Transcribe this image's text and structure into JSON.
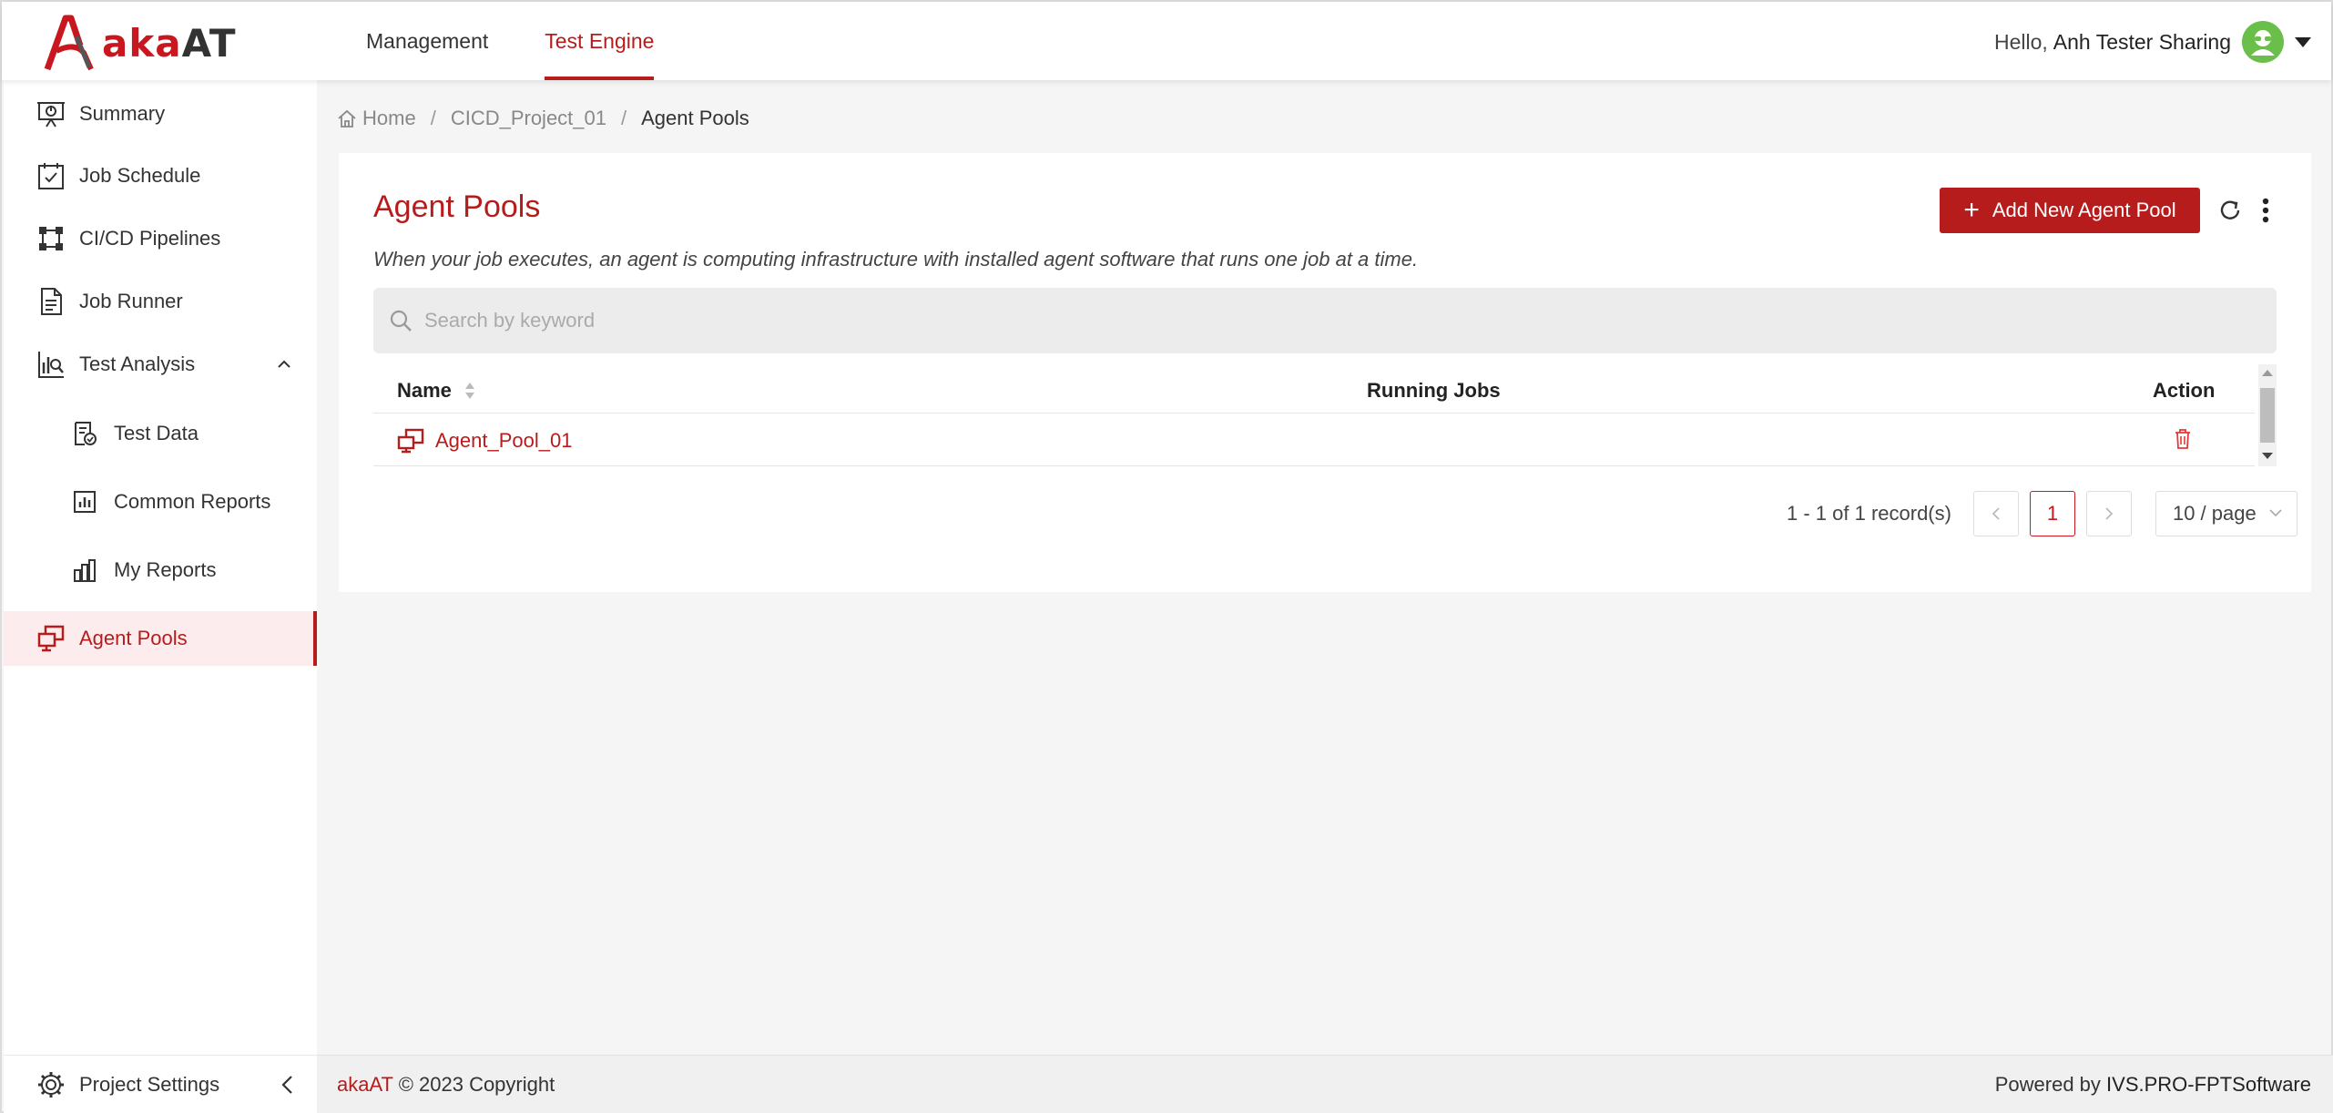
{
  "brand": {
    "logo_aka": "aka",
    "logo_at": "AT",
    "accent": "#b71c1c"
  },
  "topnav": {
    "items": [
      {
        "label": "Management",
        "active": false
      },
      {
        "label": "Test Engine",
        "active": true
      }
    ]
  },
  "user": {
    "greeting": "Hello,",
    "name": "Anh Tester Sharing"
  },
  "sidebar": {
    "items": [
      {
        "label": "Summary",
        "icon": "presentation-icon"
      },
      {
        "label": "Job Schedule",
        "icon": "calendar-check-icon"
      },
      {
        "label": "CI/CD Pipelines",
        "icon": "pipeline-icon"
      },
      {
        "label": "Job Runner",
        "icon": "document-icon"
      },
      {
        "label": "Test Analysis",
        "icon": "chart-search-icon",
        "expanded": true
      },
      {
        "label": "Test Data",
        "icon": "file-check-icon",
        "sub": true
      },
      {
        "label": "Common Reports",
        "icon": "bar-chart-icon",
        "sub": true
      },
      {
        "label": "My Reports",
        "icon": "bar-chart-icon",
        "sub": true
      },
      {
        "label": "Agent Pools",
        "icon": "monitors-icon",
        "active": true
      }
    ],
    "settings_label": "Project Settings"
  },
  "breadcrumb": {
    "home": "Home",
    "project": "CICD_Project_01",
    "current": "Agent Pools"
  },
  "page": {
    "title": "Agent Pools",
    "description": "When your job executes, an agent is computing infrastructure with installed agent software that runs one job at a time.",
    "add_button": "Add New Agent Pool",
    "search_placeholder": "Search by keyword"
  },
  "table": {
    "columns": [
      "Name",
      "Running Jobs",
      "Action"
    ],
    "rows": [
      {
        "name": "Agent_Pool_01",
        "running_jobs": ""
      }
    ]
  },
  "pagination": {
    "summary": "1 - 1 of 1 record(s)",
    "current_page": "1",
    "page_size": "10 / page"
  },
  "footer": {
    "brand": "akaAT",
    "copyright": "© 2023 Copyright",
    "powered_by": "Powered by",
    "org": "IVS.PRO-FPTSoftware"
  }
}
